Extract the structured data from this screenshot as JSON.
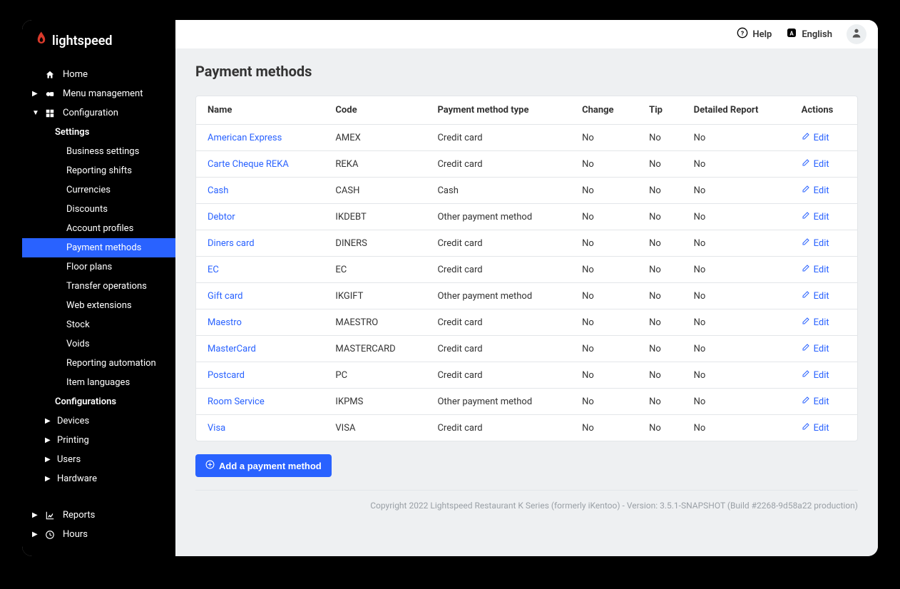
{
  "brand": "lightspeed",
  "topbar": {
    "help": "Help",
    "language": "English"
  },
  "nav": {
    "home": "Home",
    "menu_management": "Menu management",
    "configuration": "Configuration",
    "settings": "Settings",
    "settings_children": [
      "Business settings",
      "Reporting shifts",
      "Currencies",
      "Discounts",
      "Account profiles",
      "Payment methods",
      "Floor plans",
      "Transfer operations",
      "Web extensions",
      "Stock",
      "Voids",
      "Reporting automation",
      "Item languages"
    ],
    "configurations": "Configurations",
    "devices": "Devices",
    "printing": "Printing",
    "users": "Users",
    "hardware": "Hardware",
    "reports": "Reports",
    "hours": "Hours"
  },
  "page": {
    "title": "Payment methods",
    "add_button": "Add a payment method",
    "edit_label": "Edit",
    "footer": "Copyright 2022 Lightspeed Restaurant K Series (formerly iKentoo) - Version: 3.5.1-SNAPSHOT (Build #2268-9d58a22 production)"
  },
  "table": {
    "headers": {
      "name": "Name",
      "code": "Code",
      "type": "Payment method type",
      "change": "Change",
      "tip": "Tip",
      "detailed": "Detailed Report",
      "actions": "Actions"
    },
    "rows": [
      {
        "name": "American Express",
        "code": "AMEX",
        "type": "Credit card",
        "change": "No",
        "tip": "No",
        "detailed": "No"
      },
      {
        "name": "Carte Cheque REKA",
        "code": "REKA",
        "type": "Credit card",
        "change": "No",
        "tip": "No",
        "detailed": "No"
      },
      {
        "name": "Cash",
        "code": "CASH",
        "type": "Cash",
        "change": "No",
        "tip": "No",
        "detailed": "No"
      },
      {
        "name": "Debtor",
        "code": "IKDEBT",
        "type": "Other payment method",
        "change": "No",
        "tip": "No",
        "detailed": "No"
      },
      {
        "name": "Diners card",
        "code": "DINERS",
        "type": "Credit card",
        "change": "No",
        "tip": "No",
        "detailed": "No"
      },
      {
        "name": "EC",
        "code": "EC",
        "type": "Credit card",
        "change": "No",
        "tip": "No",
        "detailed": "No"
      },
      {
        "name": "Gift card",
        "code": "IKGIFT",
        "type": "Other payment method",
        "change": "No",
        "tip": "No",
        "detailed": "No"
      },
      {
        "name": "Maestro",
        "code": "MAESTRO",
        "type": "Credit card",
        "change": "No",
        "tip": "No",
        "detailed": "No"
      },
      {
        "name": "MasterCard",
        "code": "MASTERCARD",
        "type": "Credit card",
        "change": "No",
        "tip": "No",
        "detailed": "No"
      },
      {
        "name": "Postcard",
        "code": "PC",
        "type": "Credit card",
        "change": "No",
        "tip": "No",
        "detailed": "No"
      },
      {
        "name": "Room Service",
        "code": "IKPMS",
        "type": "Other payment method",
        "change": "No",
        "tip": "No",
        "detailed": "No"
      },
      {
        "name": "Visa",
        "code": "VISA",
        "type": "Credit card",
        "change": "No",
        "tip": "No",
        "detailed": "No"
      }
    ]
  }
}
